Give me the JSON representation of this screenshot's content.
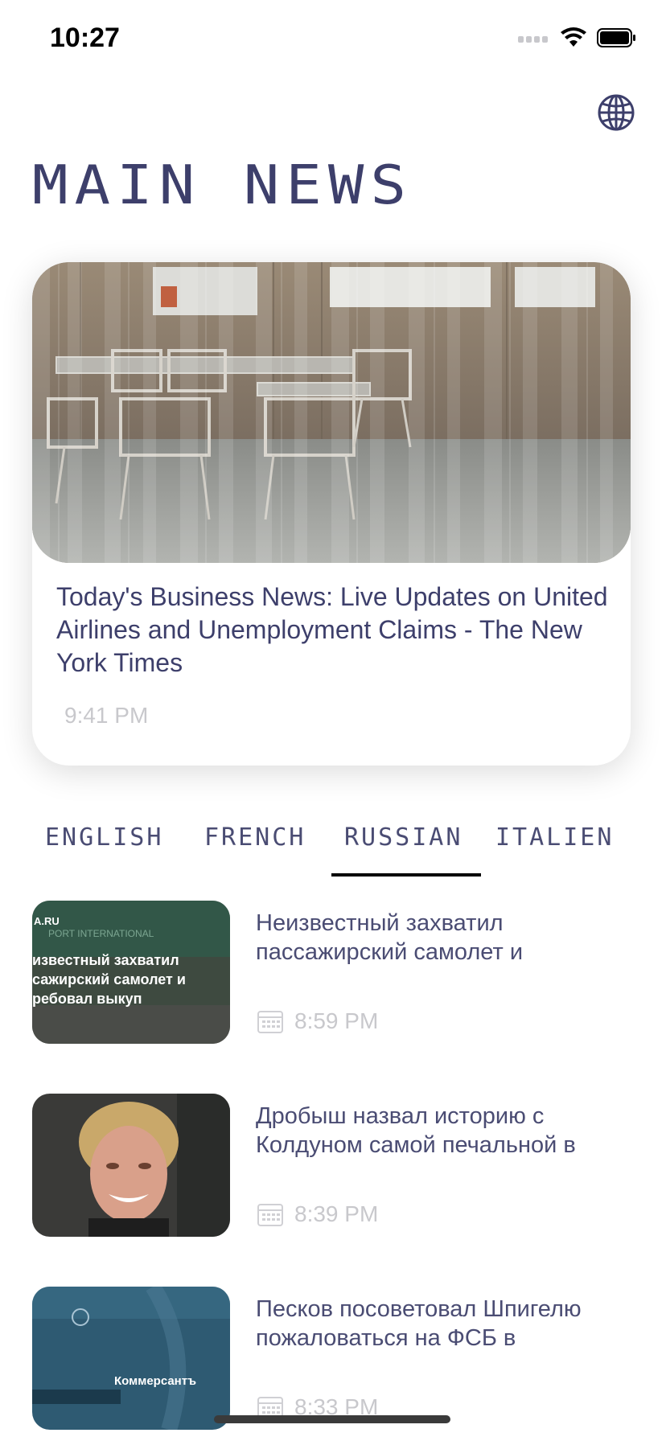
{
  "status_bar": {
    "time": "10:27"
  },
  "header": {
    "title": "MAIN NEWS",
    "globe_icon": "globe-icon"
  },
  "featured": {
    "headline": "Today's Business News: Live Updates on United Airlines and Unemployment Claims - The New York Times",
    "time": "9:41 PM"
  },
  "tabs": [
    {
      "label": "ENGLISH",
      "active": false
    },
    {
      "label": "FRENCH",
      "active": false
    },
    {
      "label": "RUSSIAN",
      "active": true
    },
    {
      "label": "ITALIEN",
      "active": false
    }
  ],
  "news": [
    {
      "headline": "Неизвестный захватил пассажирский самолет и",
      "time": "8:59 PM",
      "thumb_text": [
        "A.RU",
        "известный захватил",
        "сажирский самолет и",
        "ребовал выкуп"
      ]
    },
    {
      "headline": "Дробыш назвал историю с Колдуном самой печальной в",
      "time": "8:39 PM"
    },
    {
      "headline": "Песков посоветовал Шпигелю пожаловаться на ФСБ в",
      "time": "8:33 PM",
      "thumb_text": [
        "Коммерсантъ"
      ]
    }
  ],
  "colors": {
    "text": "#3d3f6b",
    "muted": "#c8c8cc",
    "underline": "#000000"
  }
}
